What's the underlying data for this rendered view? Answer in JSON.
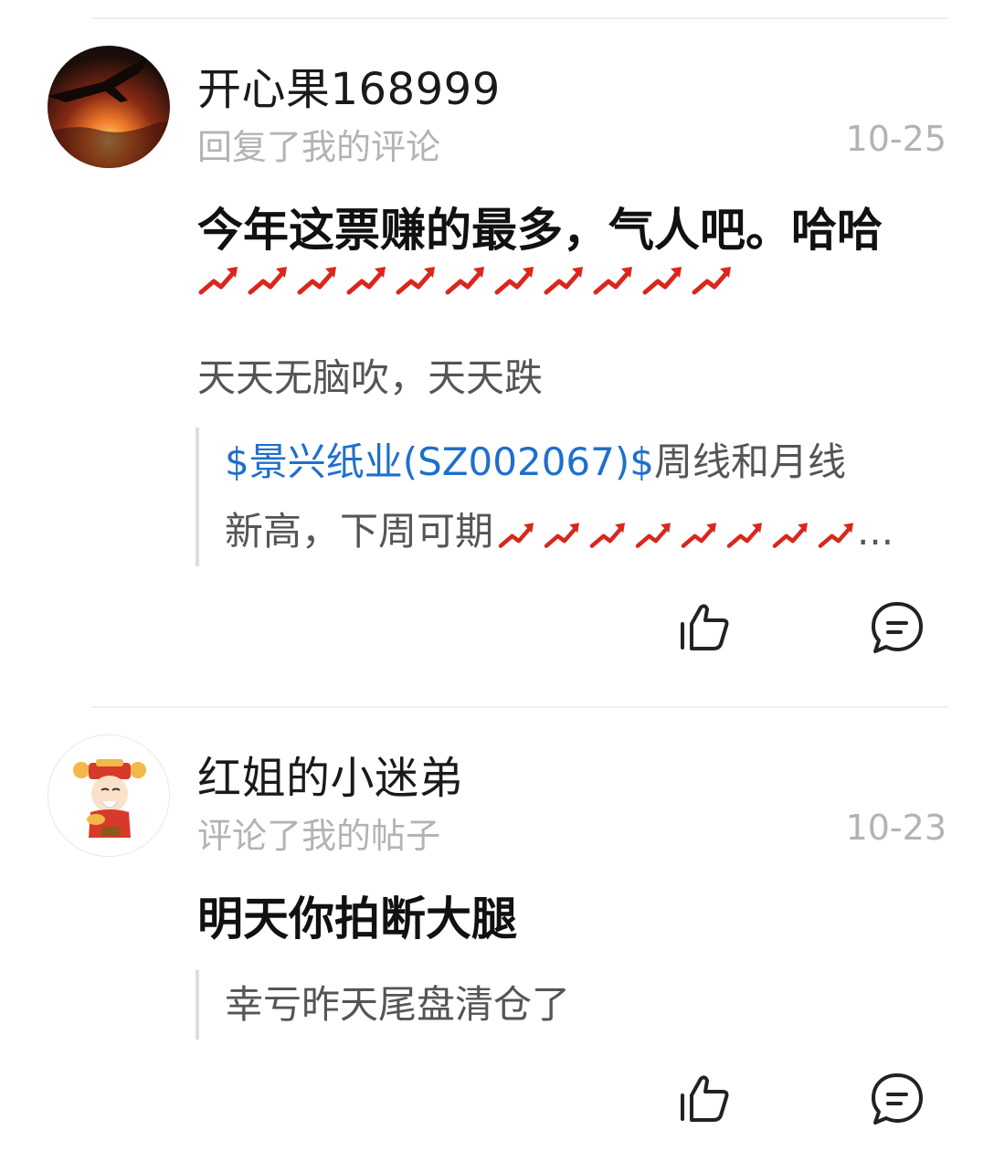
{
  "colors": {
    "link": "#1f6fcc",
    "muted": "#b3b3b3",
    "arrow_red": "#d9271e"
  },
  "comments": [
    {
      "username": "开心果168999",
      "action": "回复了我的评论",
      "time": "10-25",
      "text": "今年这票赚的最多，气人吧。哈哈",
      "text_arrow_icons": 11,
      "reply_text": "天天无脑吹，天天跌",
      "quote": {
        "link": "$景兴纸业(SZ002067)$",
        "line1_rest": "周线和月线",
        "line2": "新高，下周可期",
        "arrow_icons": 8,
        "ellipsis": "..."
      },
      "avatar_icon": "airplane-sunset-avatar",
      "like_icon": "thumbs-up-icon",
      "reply_icon": "comment-bubble-icon"
    },
    {
      "username": "红姐的小迷弟",
      "action": "评论了我的帖子",
      "time": "10-23",
      "text": "明天你拍断大腿",
      "quote": {
        "text": "幸亏昨天尾盘清仓了"
      },
      "avatar_icon": "fortune-god-avatar",
      "like_icon": "thumbs-up-icon",
      "reply_icon": "comment-bubble-icon"
    }
  ]
}
